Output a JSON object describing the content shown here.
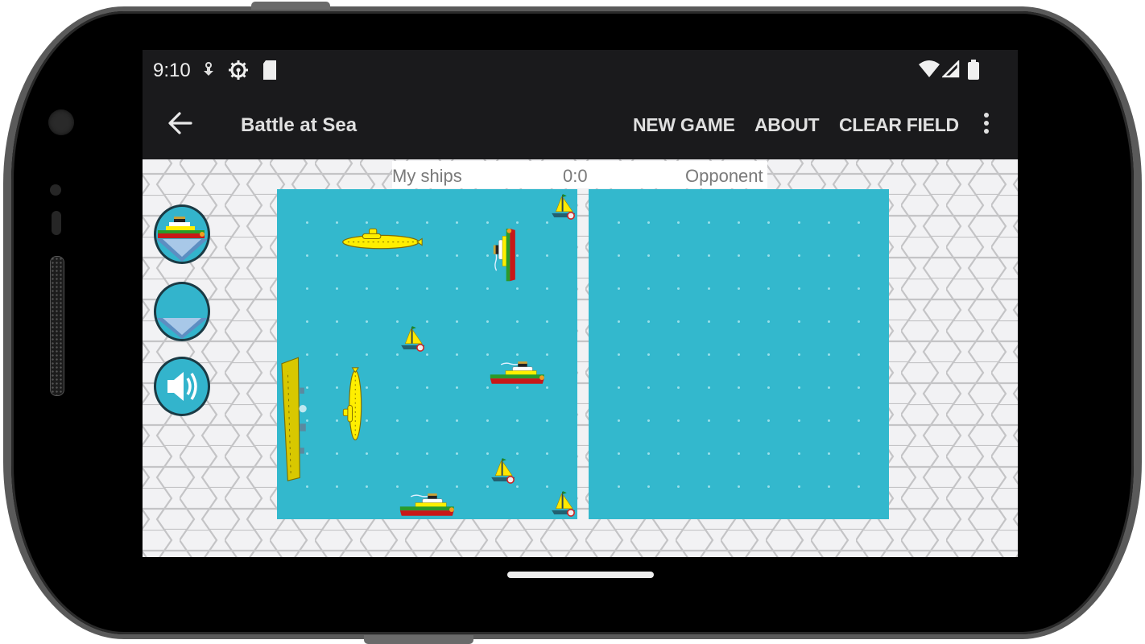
{
  "device": {
    "type": "android-phone-landscape"
  },
  "status_bar": {
    "time": "9:10",
    "left_icons": [
      "download-icon",
      "settings-gear-icon",
      "sd-card-icon"
    ],
    "right_icons": [
      "wifi-icon",
      "signal-icon",
      "battery-icon"
    ]
  },
  "app_bar": {
    "title": "Battle at Sea",
    "back_icon": "arrow-left-icon",
    "actions": [
      {
        "label": "NEW GAME"
      },
      {
        "label": "ABOUT"
      },
      {
        "label": "CLEAR FIELD"
      }
    ],
    "overflow_icon": "more-vert-icon"
  },
  "game": {
    "my_label": "My ships",
    "score": "0:0",
    "opponent_label": "Opponent",
    "sea_color": "#33b8cd",
    "side_buttons": [
      {
        "name": "ship-placement-button",
        "icon": "ship-icon"
      },
      {
        "name": "empty-sea-button",
        "icon": "sea-icon"
      },
      {
        "name": "sound-button",
        "icon": "speaker-icon"
      }
    ],
    "grid": {
      "columns": 10,
      "rows": 10
    },
    "my_fleet": [
      {
        "type": "sailboat",
        "orientation": "horizontal",
        "col": 9,
        "row": 0,
        "length": 1
      },
      {
        "type": "submarine",
        "orientation": "horizontal",
        "col": 2,
        "row": 1,
        "length": 3
      },
      {
        "type": "steamboat",
        "orientation": "vertical",
        "col": 7,
        "row": 1,
        "length": 2
      },
      {
        "type": "sailboat",
        "orientation": "horizontal",
        "col": 4,
        "row": 4,
        "length": 1
      },
      {
        "type": "steamboat",
        "orientation": "horizontal",
        "col": 7,
        "row": 5,
        "length": 2
      },
      {
        "type": "aircraft-carrier",
        "orientation": "vertical",
        "col": 0,
        "row": 5,
        "length": 4
      },
      {
        "type": "submarine",
        "orientation": "vertical",
        "col": 2,
        "row": 5,
        "length": 3
      },
      {
        "type": "sailboat",
        "orientation": "horizontal",
        "col": 7,
        "row": 8,
        "length": 1
      },
      {
        "type": "steamboat",
        "orientation": "horizontal",
        "col": 4,
        "row": 9,
        "length": 2
      },
      {
        "type": "sailboat",
        "orientation": "horizontal",
        "col": 9,
        "row": 9,
        "length": 1
      }
    ],
    "opponent_fleet": []
  },
  "nav_bar": {
    "home_handle": "home-gesture-bar"
  }
}
